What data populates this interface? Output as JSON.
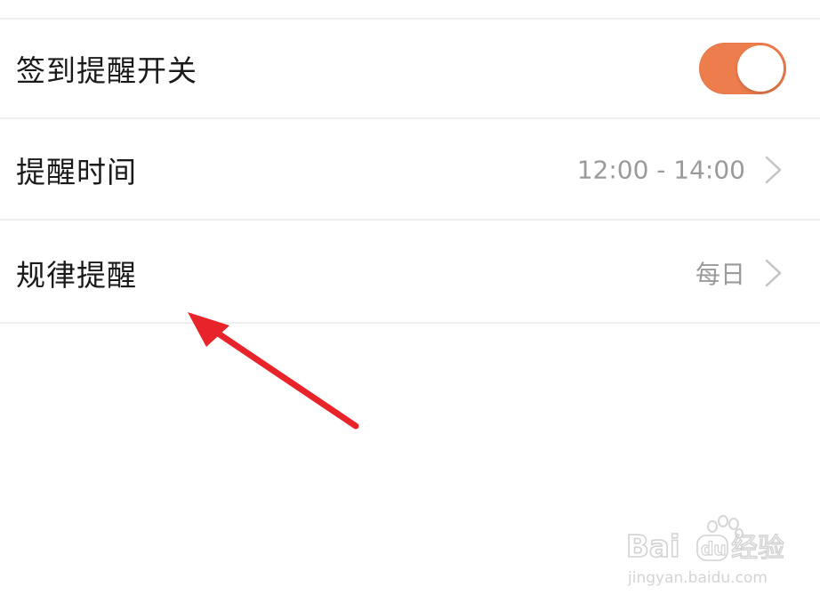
{
  "settings": {
    "rows": [
      {
        "label": "签到提醒开关",
        "type": "toggle",
        "toggle_on": true
      },
      {
        "label": "提醒时间",
        "type": "value",
        "value": "12:00 - 14:00"
      },
      {
        "label": "规律提醒",
        "type": "value",
        "value": "每日"
      }
    ]
  },
  "colors": {
    "toggle_on": "#ee7d4d",
    "annotation_arrow": "#e8232a",
    "label_text": "#1a1a1a",
    "value_text": "#9a9a9a"
  },
  "icons": {
    "chevron": "chevron-right-icon",
    "annotation": "arrow-annotation"
  },
  "watermark": {
    "brand": "Baidu经验",
    "url": "jingyan.baidu.com"
  }
}
